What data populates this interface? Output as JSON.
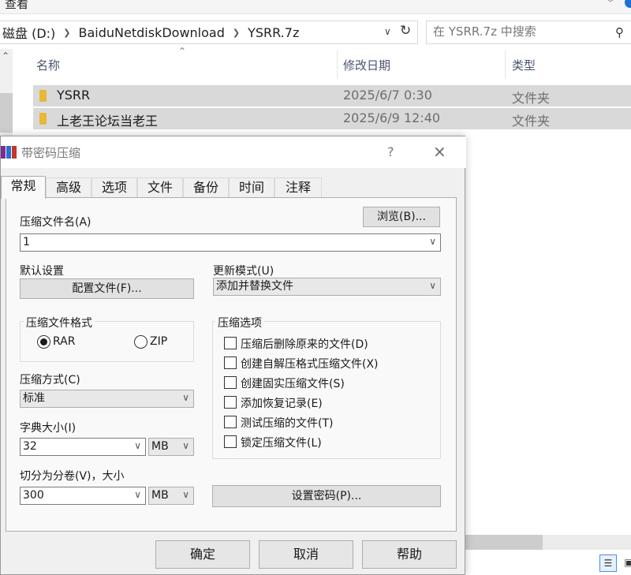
{
  "explorer": {
    "ribbon_view": "查看",
    "breadcrumbs": [
      "磁盘 (D:)",
      "BaiduNetdiskDownload",
      "YSRR.7z"
    ],
    "search_placeholder": "在 YSRR.7z 中搜索",
    "columns": {
      "name": "名称",
      "date": "修改日期",
      "type": "类型"
    },
    "rows": [
      {
        "name": "YSRR",
        "date": "2025/6/7 0:30",
        "type": "文件夹"
      },
      {
        "name": "上老王论坛当老王",
        "date": "2025/6/9 12:40",
        "type": "文件夹"
      }
    ]
  },
  "dialog": {
    "title": "带密码压缩",
    "help": "?",
    "close": "×",
    "tabs": [
      "常规",
      "高级",
      "选项",
      "文件",
      "备份",
      "时间",
      "注释"
    ],
    "active_tab": "常规",
    "archive_name_label": "压缩文件名(A)",
    "archive_name_value": "1",
    "browse_button": "浏览(B)...",
    "default_settings_label": "默认设置",
    "profiles_button": "配置文件(F)...",
    "update_mode_label": "更新模式(U)",
    "update_mode_value": "添加并替换文件",
    "format_group": "压缩文件格式",
    "format_rar": "RAR",
    "format_zip": "ZIP",
    "format_selected": "RAR",
    "method_label": "压缩方式(C)",
    "method_value": "标准",
    "dict_label": "字典大小(I)",
    "dict_value": "32",
    "dict_unit": "MB",
    "split_label": "切分为分卷(V)，大小",
    "split_value": "300",
    "split_unit": "MB",
    "options_group": "压缩选项",
    "options": [
      {
        "label": "压缩后删除原来的文件(D)",
        "checked": false
      },
      {
        "label": "创建自解压格式压缩文件(X)",
        "checked": false
      },
      {
        "label": "创建固实压缩文件(S)",
        "checked": false
      },
      {
        "label": "添加恢复记录(E)",
        "checked": false
      },
      {
        "label": "测试压缩的文件(T)",
        "checked": false
      },
      {
        "label": "锁定压缩文件(L)",
        "checked": false
      }
    ],
    "set_password_button": "设置密码(P)...",
    "ok_button": "确定",
    "cancel_button": "取消",
    "help_button": "帮助"
  },
  "colors": {
    "selection": "#d9d9d9",
    "accent": "#1a73d1",
    "folder": "#e7b934"
  }
}
